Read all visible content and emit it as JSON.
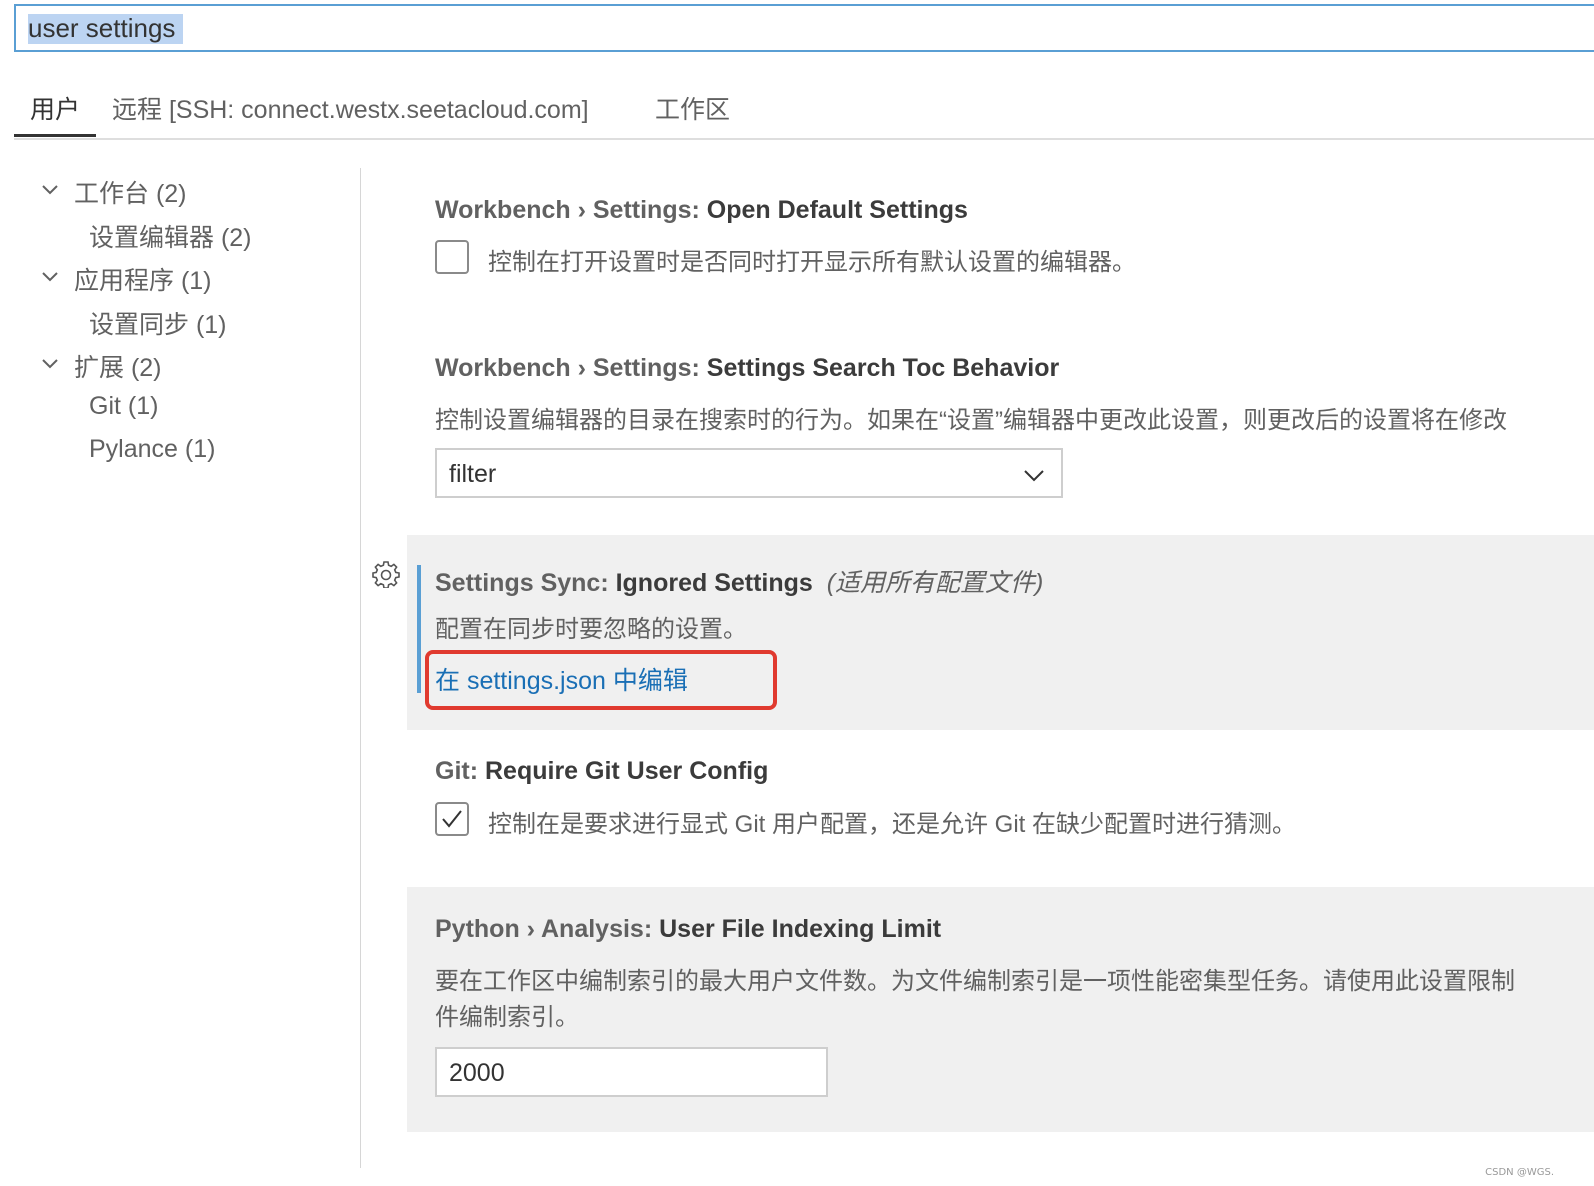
{
  "search": {
    "value": "user settings"
  },
  "tabs": [
    {
      "label": "用户"
    },
    {
      "label": "远程 [SSH: connect.westx.seetacloud.com]"
    },
    {
      "label": "工作区"
    }
  ],
  "toc": [
    {
      "label": "工作台 (2)"
    },
    {
      "label": "设置编辑器 (2)"
    },
    {
      "label": "应用程序 (1)"
    },
    {
      "label": "设置同步 (1)"
    },
    {
      "label": "扩展 (2)"
    },
    {
      "label": "Git (1)"
    },
    {
      "label": "Pylance (1)"
    }
  ],
  "settings": [
    {
      "category": "Workbench › Settings: ",
      "name": "Open Default Settings",
      "description": "控制在打开设置时是否同时打开显示所有默认设置的编辑器。",
      "checked": false
    },
    {
      "category": "Workbench › Settings: ",
      "name": "Settings Search Toc Behavior",
      "description": "控制设置编辑器的目录在搜索时的行为。如果在“设置”编辑器中更改此设置，则更改后的设置将在修改",
      "value": "filter"
    },
    {
      "category": "Settings Sync: ",
      "name": "Ignored Settings",
      "scope": "(适用所有配置文件)",
      "description": "配置在同步时要忽略的设置。",
      "link": "在 settings.json 中编辑"
    },
    {
      "category": "Git: ",
      "name": "Require Git User Config",
      "description": "控制在是要求进行显式 Git 用户配置，还是允许 Git 在缺少配置时进行猜测。",
      "checked": true
    },
    {
      "category": "Python › Analysis: ",
      "name": "User File Indexing Limit",
      "description_line1": "要在工作区中编制索引的最大用户文件数。为文件编制索引是一项性能密集型任务。请使用此设置限制",
      "description_line2": "件编制索引。",
      "value": "2000"
    }
  ],
  "watermark": "CSDN @WGS."
}
